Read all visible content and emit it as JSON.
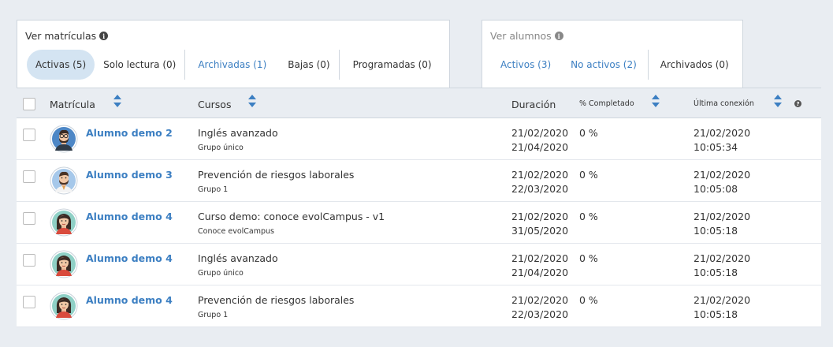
{
  "colors": {
    "accent": "#3c7fc2",
    "active_pill": "#d4e4f2",
    "page_bg": "#e9edf2"
  },
  "matriculas_panel": {
    "title": "Ver matrículas",
    "filters": [
      {
        "label": "Activas (5)",
        "active": true,
        "link": false
      },
      {
        "label": "Solo lectura (0)",
        "active": false,
        "link": false
      },
      {
        "label": "Archivadas (1)",
        "active": false,
        "link": true
      },
      {
        "label": "Bajas (0)",
        "active": false,
        "link": false
      },
      {
        "label": "Programadas (0)",
        "active": false,
        "link": false
      }
    ]
  },
  "alumnos_panel": {
    "title": "Ver alumnos",
    "filters": [
      {
        "label": "Activos (3)",
        "link": true
      },
      {
        "label": "No activos (2)",
        "link": true
      },
      {
        "label": "Archivados (0)",
        "link": false
      }
    ]
  },
  "table": {
    "headers": {
      "matricula": "Matrícula",
      "cursos": "Cursos",
      "duracion": "Duración",
      "completado": "% Completado",
      "ultima_conexion": "Última conexión"
    },
    "rows": [
      {
        "avatar": "male-glasses-avatar",
        "name": "Alumno demo 2",
        "course": "Inglés avanzado",
        "group": "Grupo único",
        "start": "21/02/2020",
        "end": "21/04/2020",
        "pct": "0 %",
        "last_date": "21/02/2020",
        "last_time": "10:05:34"
      },
      {
        "avatar": "male-beard-avatar",
        "name": "Alumno demo 3",
        "course": "Prevención de riesgos laborales",
        "group": "Grupo 1",
        "start": "21/02/2020",
        "end": "22/03/2020",
        "pct": "0 %",
        "last_date": "21/02/2020",
        "last_time": "10:05:08"
      },
      {
        "avatar": "female-avatar",
        "name": "Alumno demo 4",
        "course": "Curso demo: conoce evolCampus - v1",
        "group": "Conoce evolCampus",
        "start": "21/02/2020",
        "end": "31/05/2020",
        "pct": "0 %",
        "last_date": "21/02/2020",
        "last_time": "10:05:18"
      },
      {
        "avatar": "female-avatar",
        "name": "Alumno demo 4",
        "course": "Inglés avanzado",
        "group": "Grupo único",
        "start": "21/02/2020",
        "end": "21/04/2020",
        "pct": "0 %",
        "last_date": "21/02/2020",
        "last_time": "10:05:18"
      },
      {
        "avatar": "female-avatar",
        "name": "Alumno demo 4",
        "course": "Prevención de riesgos laborales",
        "group": "Grupo 1",
        "start": "21/02/2020",
        "end": "22/03/2020",
        "pct": "0 %",
        "last_date": "21/02/2020",
        "last_time": "10:05:18"
      }
    ]
  }
}
